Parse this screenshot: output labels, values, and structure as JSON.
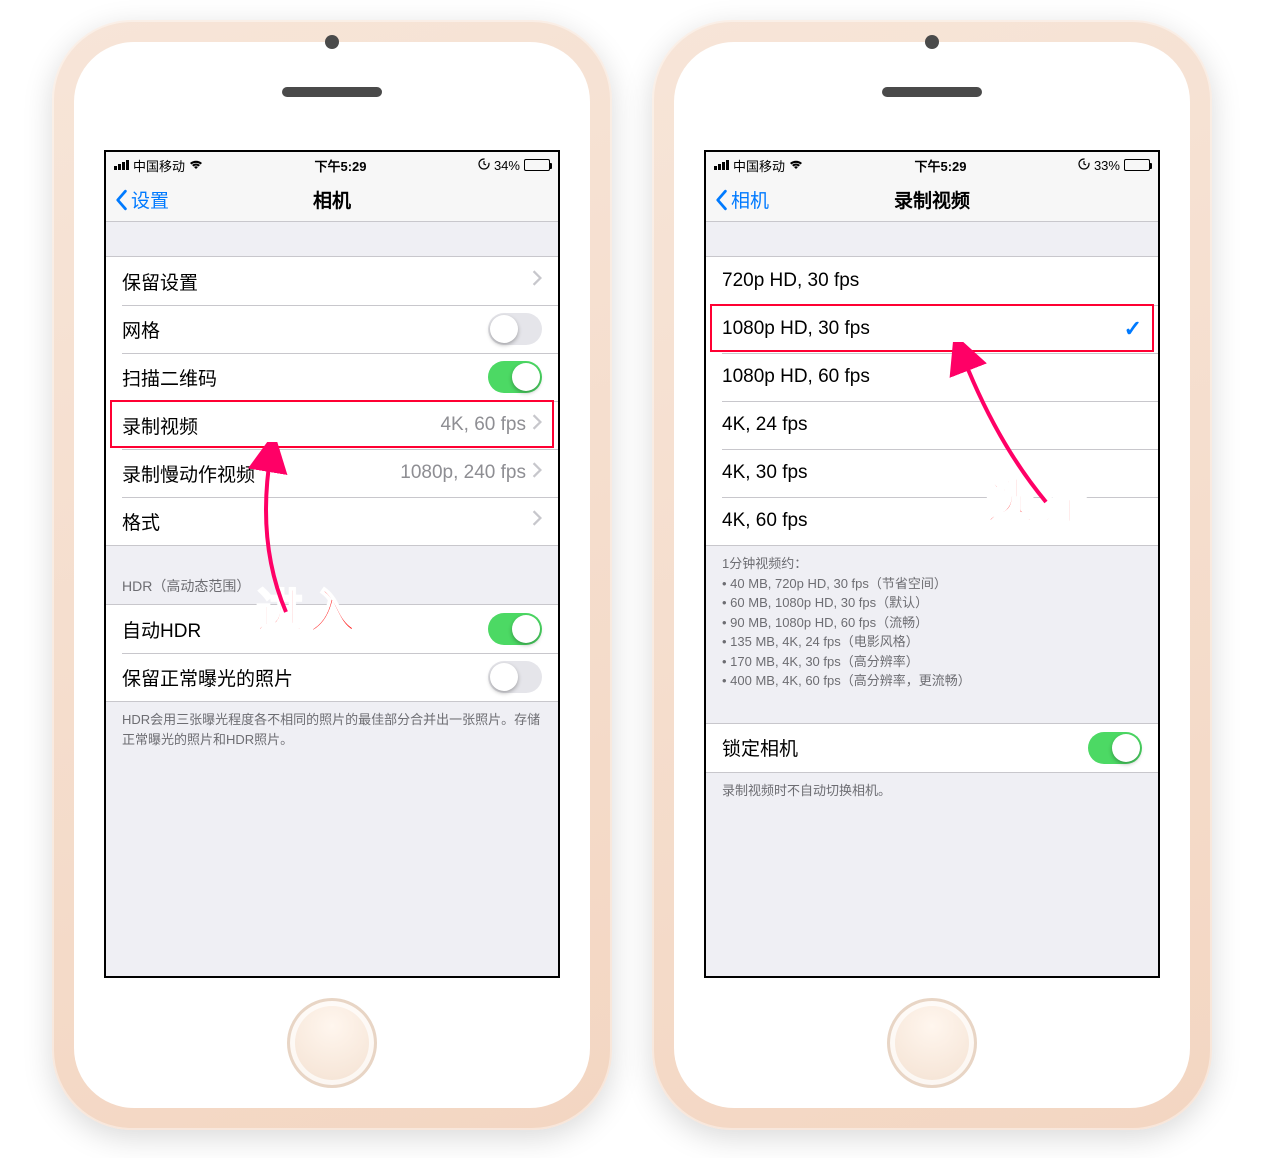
{
  "phoneLeft": {
    "status": {
      "carrier": "中国移动",
      "time": "下午5:29",
      "battery": "34%",
      "battery_fill": "34%"
    },
    "nav": {
      "back": "设置",
      "title": "相机"
    },
    "rows": {
      "preserve": "保留设置",
      "grid": "网格",
      "qr": "扫描二维码",
      "record_video": "录制视频",
      "record_video_val": "4K, 60 fps",
      "record_slomo": "录制慢动作视频",
      "record_slomo_val": "1080p, 240 fps",
      "formats": "格式"
    },
    "hdr_header": "HDR（高动态范围）",
    "auto_hdr": "自动HDR",
    "keep_normal": "保留正常曝光的照片",
    "hdr_footer": "HDR会用三张曝光程度各不相同的照片的最佳部分合并出一张照片。存储正常曝光的照片和HDR照片。",
    "annotation": "进入"
  },
  "phoneRight": {
    "status": {
      "carrier": "中国移动",
      "time": "下午5:29",
      "battery": "33%",
      "battery_fill": "33%"
    },
    "nav": {
      "back": "相机",
      "title": "录制视频"
    },
    "options": [
      "720p HD, 30 fps",
      "1080p HD, 30 fps",
      "1080p HD, 60 fps",
      "4K, 24 fps",
      "4K, 30 fps",
      "4K, 60 fps"
    ],
    "selected_index": 1,
    "footer_title": "1分钟视频约：",
    "footer_lines": [
      "• 40 MB, 720p HD, 30 fps（节省空间）",
      "• 60 MB, 1080p HD, 30 fps（默认）",
      "• 90 MB, 1080p HD, 60 fps（流畅）",
      "• 135 MB, 4K, 24 fps（电影风格）",
      "• 170 MB, 4K, 30 fps（高分辨率）",
      "• 400 MB, 4K, 60 fps（高分辨率，更流畅）"
    ],
    "lock_camera": "锁定相机",
    "lock_footer": "录制视频时不自动切换相机。",
    "annotation": "选择"
  }
}
